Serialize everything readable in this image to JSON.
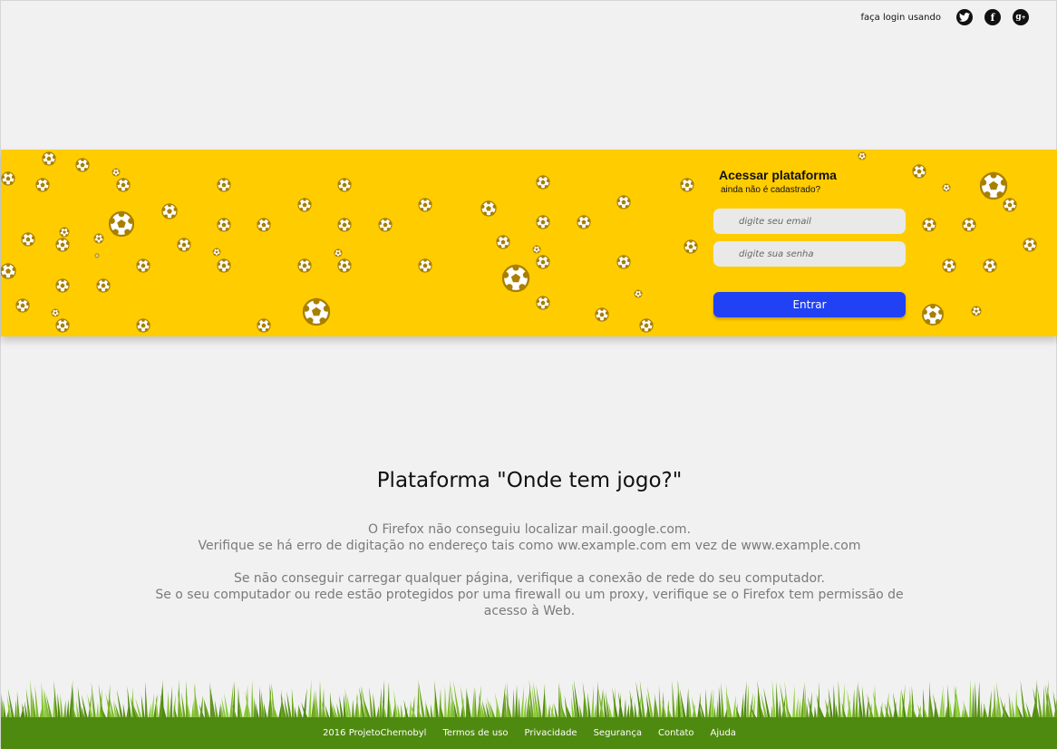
{
  "topbar": {
    "login_label": "faça login usando",
    "icons": [
      "twitter-icon",
      "facebook-icon",
      "google-plus-icon"
    ]
  },
  "login_panel": {
    "title": "Acessar plataforma",
    "subtitle": "ainda não é cadastrado?",
    "email_placeholder": "digite seu email",
    "password_placeholder": "digite sua senha",
    "submit_label": "Entrar"
  },
  "main": {
    "heading": "Plataforma \"Onde tem jogo?\"",
    "line1": "O Firefox não conseguiu localizar mail.google.com.",
    "line2": "Verifique se há erro de digitação no endereço tais como  ww.example.com em vez de  www.example.com",
    "line3": "Se não conseguir carregar qualquer página, verifique a conexão de rede  do seu computador.",
    "line4": "Se o seu computador ou rede estão protegidos por uma firewall ou um proxy, verifique se o Firefox tem permissão de acesso à Web."
  },
  "footer": {
    "links": [
      "2016 ProjetoChernobyl",
      "Termos de uso",
      "Privacidade",
      "Segurança",
      "Contato",
      "Ajuda"
    ]
  },
  "colors": {
    "band": "#ffcc00",
    "ball": "#a87f00",
    "button": "#2141f5",
    "footer": "#4f8a10",
    "background": "#f1f1f1"
  }
}
